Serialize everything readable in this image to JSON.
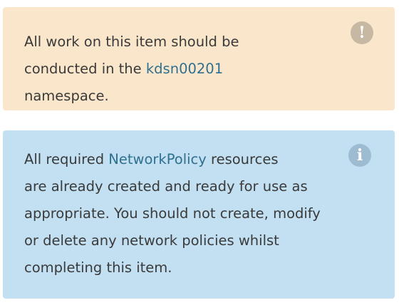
{
  "warning_callout": {
    "icon": "exclamation-icon",
    "lines": [
      {
        "text": "All work on this item should be"
      },
      {
        "text_before": "conducted in the ",
        "code": "kdsn00201"
      },
      {
        "text": "namespace."
      }
    ]
  },
  "info_callout": {
    "icon": "info-icon",
    "lines": [
      {
        "text_before": "All required ",
        "code": "NetworkPolicy",
        "text_after": " resources"
      },
      {
        "text": "are already created and ready for use as"
      },
      {
        "text": "appropriate. You should not create, modify"
      },
      {
        "text": "or delete any network policies whilst"
      },
      {
        "text": "completing this item."
      }
    ]
  },
  "icons": {
    "warning_glyph": "!",
    "info_glyph": "i"
  },
  "colors": {
    "warning_background": "#fae7cb",
    "info_background": "#c2e0f2",
    "code_text": "#2f6f8f",
    "body_text": "#3a3a3a"
  }
}
